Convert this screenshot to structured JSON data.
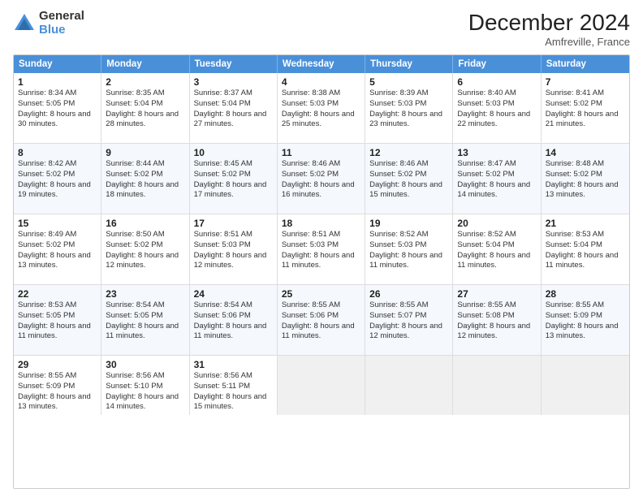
{
  "logo": {
    "general": "General",
    "blue": "Blue"
  },
  "title": "December 2024",
  "location": "Amfreville, France",
  "header_days": [
    "Sunday",
    "Monday",
    "Tuesday",
    "Wednesday",
    "Thursday",
    "Friday",
    "Saturday"
  ],
  "weeks": [
    [
      {
        "day": "1",
        "sunrise": "Sunrise: 8:34 AM",
        "sunset": "Sunset: 5:05 PM",
        "daylight": "Daylight: 8 hours and 30 minutes."
      },
      {
        "day": "2",
        "sunrise": "Sunrise: 8:35 AM",
        "sunset": "Sunset: 5:04 PM",
        "daylight": "Daylight: 8 hours and 28 minutes."
      },
      {
        "day": "3",
        "sunrise": "Sunrise: 8:37 AM",
        "sunset": "Sunset: 5:04 PM",
        "daylight": "Daylight: 8 hours and 27 minutes."
      },
      {
        "day": "4",
        "sunrise": "Sunrise: 8:38 AM",
        "sunset": "Sunset: 5:03 PM",
        "daylight": "Daylight: 8 hours and 25 minutes."
      },
      {
        "day": "5",
        "sunrise": "Sunrise: 8:39 AM",
        "sunset": "Sunset: 5:03 PM",
        "daylight": "Daylight: 8 hours and 23 minutes."
      },
      {
        "day": "6",
        "sunrise": "Sunrise: 8:40 AM",
        "sunset": "Sunset: 5:03 PM",
        "daylight": "Daylight: 8 hours and 22 minutes."
      },
      {
        "day": "7",
        "sunrise": "Sunrise: 8:41 AM",
        "sunset": "Sunset: 5:02 PM",
        "daylight": "Daylight: 8 hours and 21 minutes."
      }
    ],
    [
      {
        "day": "8",
        "sunrise": "Sunrise: 8:42 AM",
        "sunset": "Sunset: 5:02 PM",
        "daylight": "Daylight: 8 hours and 19 minutes."
      },
      {
        "day": "9",
        "sunrise": "Sunrise: 8:44 AM",
        "sunset": "Sunset: 5:02 PM",
        "daylight": "Daylight: 8 hours and 18 minutes."
      },
      {
        "day": "10",
        "sunrise": "Sunrise: 8:45 AM",
        "sunset": "Sunset: 5:02 PM",
        "daylight": "Daylight: 8 hours and 17 minutes."
      },
      {
        "day": "11",
        "sunrise": "Sunrise: 8:46 AM",
        "sunset": "Sunset: 5:02 PM",
        "daylight": "Daylight: 8 hours and 16 minutes."
      },
      {
        "day": "12",
        "sunrise": "Sunrise: 8:46 AM",
        "sunset": "Sunset: 5:02 PM",
        "daylight": "Daylight: 8 hours and 15 minutes."
      },
      {
        "day": "13",
        "sunrise": "Sunrise: 8:47 AM",
        "sunset": "Sunset: 5:02 PM",
        "daylight": "Daylight: 8 hours and 14 minutes."
      },
      {
        "day": "14",
        "sunrise": "Sunrise: 8:48 AM",
        "sunset": "Sunset: 5:02 PM",
        "daylight": "Daylight: 8 hours and 13 minutes."
      }
    ],
    [
      {
        "day": "15",
        "sunrise": "Sunrise: 8:49 AM",
        "sunset": "Sunset: 5:02 PM",
        "daylight": "Daylight: 8 hours and 13 minutes."
      },
      {
        "day": "16",
        "sunrise": "Sunrise: 8:50 AM",
        "sunset": "Sunset: 5:02 PM",
        "daylight": "Daylight: 8 hours and 12 minutes."
      },
      {
        "day": "17",
        "sunrise": "Sunrise: 8:51 AM",
        "sunset": "Sunset: 5:03 PM",
        "daylight": "Daylight: 8 hours and 12 minutes."
      },
      {
        "day": "18",
        "sunrise": "Sunrise: 8:51 AM",
        "sunset": "Sunset: 5:03 PM",
        "daylight": "Daylight: 8 hours and 11 minutes."
      },
      {
        "day": "19",
        "sunrise": "Sunrise: 8:52 AM",
        "sunset": "Sunset: 5:03 PM",
        "daylight": "Daylight: 8 hours and 11 minutes."
      },
      {
        "day": "20",
        "sunrise": "Sunrise: 8:52 AM",
        "sunset": "Sunset: 5:04 PM",
        "daylight": "Daylight: 8 hours and 11 minutes."
      },
      {
        "day": "21",
        "sunrise": "Sunrise: 8:53 AM",
        "sunset": "Sunset: 5:04 PM",
        "daylight": "Daylight: 8 hours and 11 minutes."
      }
    ],
    [
      {
        "day": "22",
        "sunrise": "Sunrise: 8:53 AM",
        "sunset": "Sunset: 5:05 PM",
        "daylight": "Daylight: 8 hours and 11 minutes."
      },
      {
        "day": "23",
        "sunrise": "Sunrise: 8:54 AM",
        "sunset": "Sunset: 5:05 PM",
        "daylight": "Daylight: 8 hours and 11 minutes."
      },
      {
        "day": "24",
        "sunrise": "Sunrise: 8:54 AM",
        "sunset": "Sunset: 5:06 PM",
        "daylight": "Daylight: 8 hours and 11 minutes."
      },
      {
        "day": "25",
        "sunrise": "Sunrise: 8:55 AM",
        "sunset": "Sunset: 5:06 PM",
        "daylight": "Daylight: 8 hours and 11 minutes."
      },
      {
        "day": "26",
        "sunrise": "Sunrise: 8:55 AM",
        "sunset": "Sunset: 5:07 PM",
        "daylight": "Daylight: 8 hours and 12 minutes."
      },
      {
        "day": "27",
        "sunrise": "Sunrise: 8:55 AM",
        "sunset": "Sunset: 5:08 PM",
        "daylight": "Daylight: 8 hours and 12 minutes."
      },
      {
        "day": "28",
        "sunrise": "Sunrise: 8:55 AM",
        "sunset": "Sunset: 5:09 PM",
        "daylight": "Daylight: 8 hours and 13 minutes."
      }
    ],
    [
      {
        "day": "29",
        "sunrise": "Sunrise: 8:55 AM",
        "sunset": "Sunset: 5:09 PM",
        "daylight": "Daylight: 8 hours and 13 minutes."
      },
      {
        "day": "30",
        "sunrise": "Sunrise: 8:56 AM",
        "sunset": "Sunset: 5:10 PM",
        "daylight": "Daylight: 8 hours and 14 minutes."
      },
      {
        "day": "31",
        "sunrise": "Sunrise: 8:56 AM",
        "sunset": "Sunset: 5:11 PM",
        "daylight": "Daylight: 8 hours and 15 minutes."
      },
      null,
      null,
      null,
      null
    ]
  ]
}
